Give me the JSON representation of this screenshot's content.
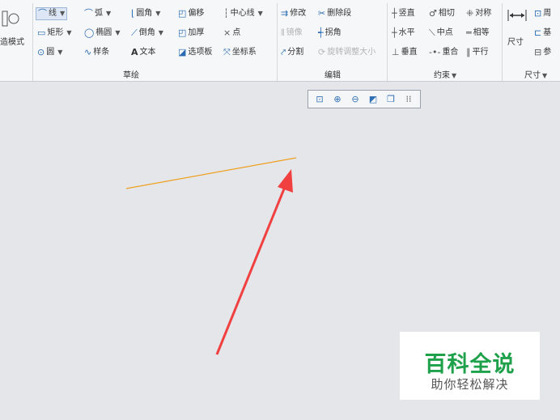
{
  "ribbon": {
    "left_cut": {
      "label1": "造模式"
    },
    "sketch": {
      "col1": {
        "line": "线",
        "rectangle": "矩形",
        "circle": "圆"
      },
      "col2": {
        "arc": "弧",
        "ellipse": "椭圆",
        "spline": "样条"
      },
      "col3": {
        "fillet": "圆角",
        "chamfer": "倒角",
        "text": "文本"
      },
      "col4": {
        "offset": "偏移",
        "thicken": "加厚",
        "palette": "选项板"
      },
      "col5": {
        "centerline": "中心线",
        "point": "点",
        "coordsys": "坐标系"
      },
      "group_label": "草绘"
    },
    "edit": {
      "modify": "修改",
      "delete_segment": "删除段",
      "mirror": "镜像",
      "corner": "拐角",
      "divide": "分割",
      "rotate_resize": "旋转调整大小",
      "group_label": "编辑"
    },
    "constrain": {
      "vertical": "竖直",
      "tangent": "相切",
      "symmetric": "对称",
      "horizontal": "水平",
      "midpoint": "中点",
      "equal": "相等",
      "perpendicular": "垂直",
      "coincident": "重合",
      "parallel": "平行",
      "group_label": "约束"
    },
    "dimension": {
      "dimension": "尺寸",
      "perimeter": "周",
      "baseline": "基",
      "reference": "参",
      "group_label": "尺寸"
    }
  },
  "view_toolbar": {
    "icons": [
      "refit-icon",
      "zoom-in-icon",
      "zoom-out-icon",
      "repaint-icon",
      "display-style-icon",
      "sketch-display-icon"
    ]
  },
  "watermark": {
    "title": "百科全说",
    "subtitle": "助你轻松解决"
  },
  "colors": {
    "sketch_line": "#f0a020",
    "arrow": "#f04040",
    "watermark_green": "#1ea14a"
  }
}
